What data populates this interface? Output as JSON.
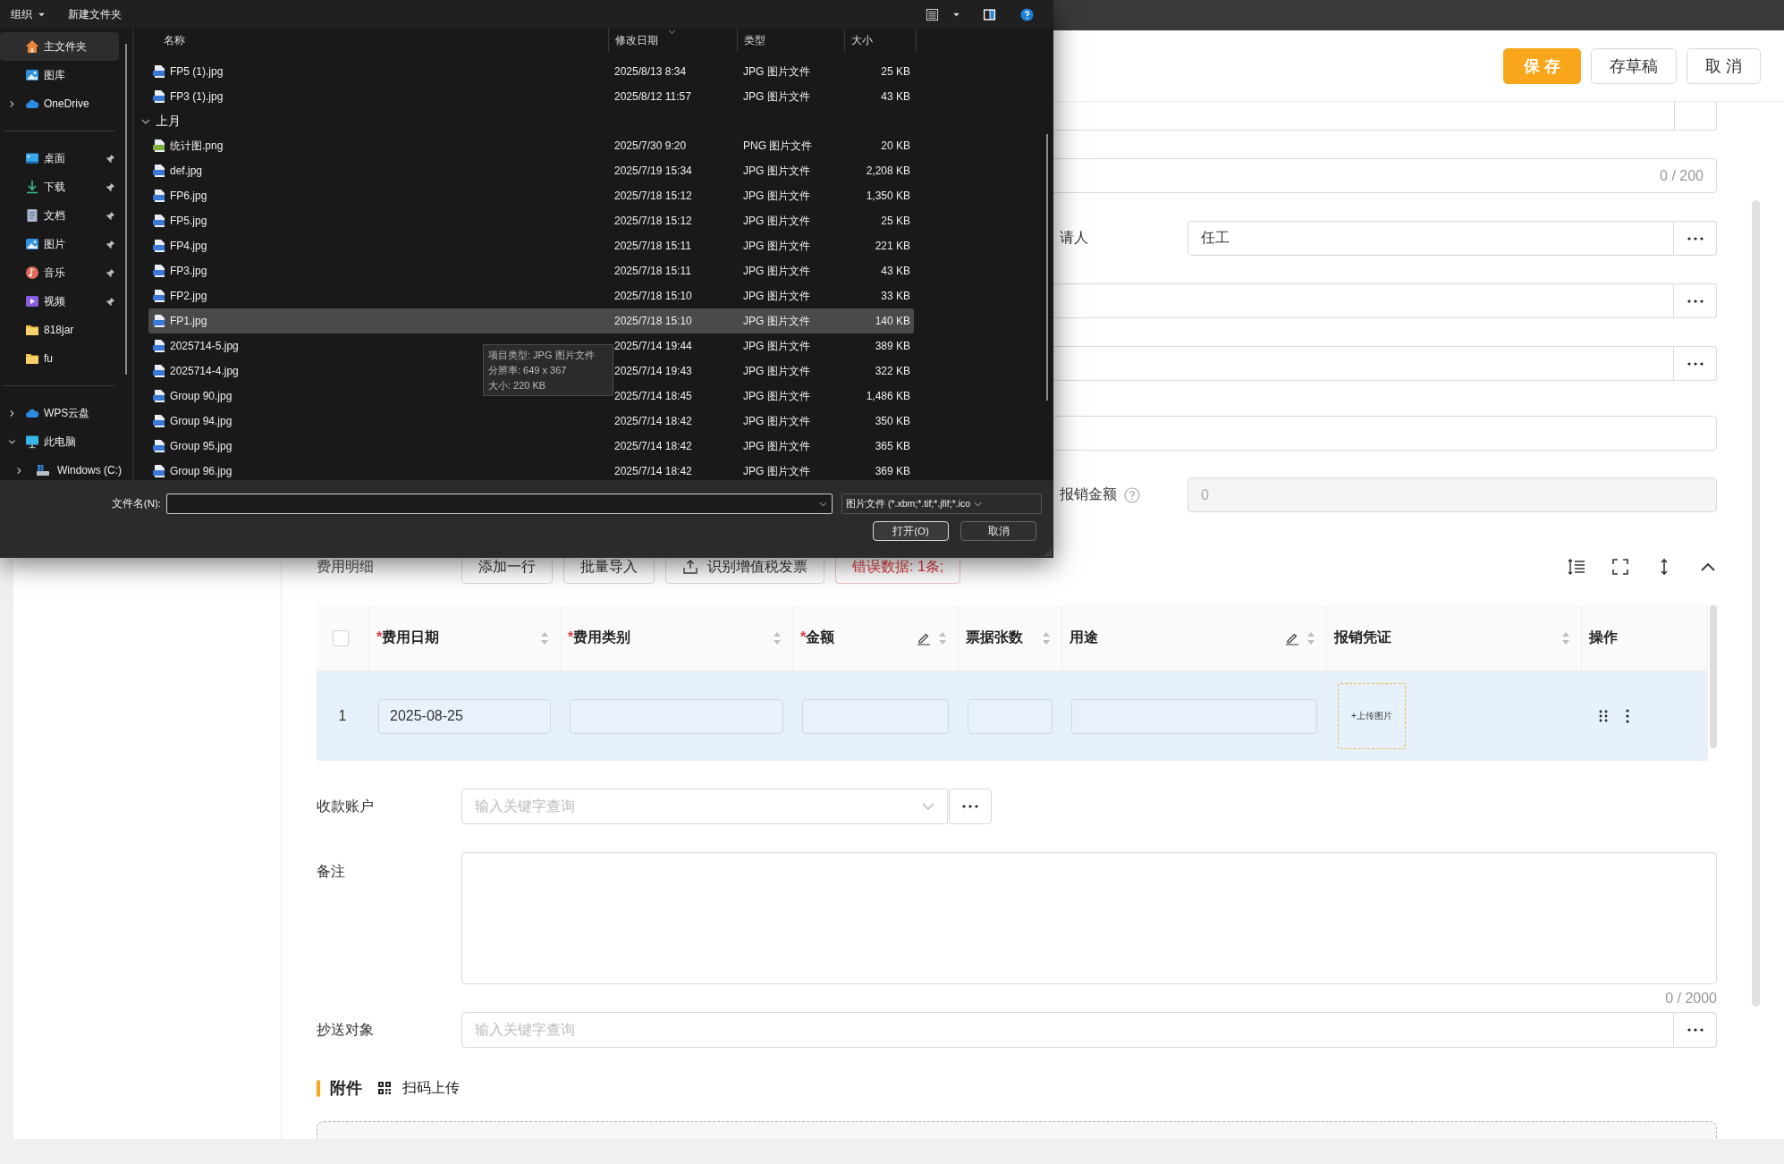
{
  "file_dialog": {
    "toolbar": {
      "organize": "组织",
      "new_folder": "新建文件夹"
    },
    "sidebar_groups": [
      [
        {
          "label": "主文件夹",
          "kind": "home",
          "selected": true,
          "pinned": false
        },
        {
          "label": "图库",
          "kind": "gallery",
          "selected": false,
          "pinned": false
        },
        {
          "label": "OneDrive",
          "kind": "cloud",
          "selected": false,
          "pinned": false,
          "expanded": false
        }
      ],
      [
        {
          "label": "桌面",
          "kind": "desktop",
          "selected": false,
          "pinned": true
        },
        {
          "label": "下载",
          "kind": "download",
          "selected": false,
          "pinned": true
        },
        {
          "label": "文档",
          "kind": "document",
          "selected": false,
          "pinned": true
        },
        {
          "label": "图片",
          "kind": "picture",
          "selected": false,
          "pinned": true
        },
        {
          "label": "音乐",
          "kind": "music",
          "selected": false,
          "pinned": true
        },
        {
          "label": "视频",
          "kind": "video",
          "selected": false,
          "pinned": true
        },
        {
          "label": "818jar",
          "kind": "folder",
          "selected": false,
          "pinned": false
        },
        {
          "label": "fu",
          "kind": "folder",
          "selected": false,
          "pinned": false
        }
      ],
      [
        {
          "label": "WPS云盘",
          "kind": "cloud",
          "selected": false,
          "pinned": false,
          "expanded": false
        },
        {
          "label": "此电脑",
          "kind": "computer",
          "selected": false,
          "pinned": false,
          "expanded": true,
          "children": [
            {
              "label": "Windows (C:)",
              "kind": "drive",
              "selected": false,
              "expanded": false
            }
          ]
        }
      ]
    ],
    "columns": [
      {
        "label": "名称",
        "sorted": false
      },
      {
        "label": "修改日期",
        "sorted": true
      },
      {
        "label": "类型",
        "sorted": false
      },
      {
        "label": "大小",
        "sorted": false
      }
    ],
    "file_groups": [
      {
        "files": [
          {
            "name": "FP5 (1).jpg",
            "date": "2025/8/13 8:34",
            "type": "JPG 图片文件",
            "size": "25 KB",
            "kind": "jpg",
            "selected": false
          },
          {
            "name": "FP3 (1).jpg",
            "date": "2025/8/12 11:57",
            "type": "JPG 图片文件",
            "size": "43 KB",
            "kind": "jpg",
            "selected": false
          }
        ]
      },
      {
        "title": "上月",
        "expanded": true,
        "files": [
          {
            "name": "统计图.png",
            "date": "2025/7/30 9:20",
            "type": "PNG 图片文件",
            "size": "20 KB",
            "kind": "png",
            "selected": false
          },
          {
            "name": "def.jpg",
            "date": "2025/7/19 15:34",
            "type": "JPG 图片文件",
            "size": "2,208 KB",
            "kind": "jpg",
            "selected": false
          },
          {
            "name": "FP6.jpg",
            "date": "2025/7/18 15:12",
            "type": "JPG 图片文件",
            "size": "1,350 KB",
            "kind": "jpg",
            "selected": false
          },
          {
            "name": "FP5.jpg",
            "date": "2025/7/18 15:12",
            "type": "JPG 图片文件",
            "size": "25 KB",
            "kind": "jpg",
            "selected": false
          },
          {
            "name": "FP4.jpg",
            "date": "2025/7/18 15:11",
            "type": "JPG 图片文件",
            "size": "221 KB",
            "kind": "jpg",
            "selected": false
          },
          {
            "name": "FP3.jpg",
            "date": "2025/7/18 15:11",
            "type": "JPG 图片文件",
            "size": "43 KB",
            "kind": "jpg",
            "selected": false
          },
          {
            "name": "FP2.jpg",
            "date": "2025/7/18 15:10",
            "type": "JPG 图片文件",
            "size": "33 KB",
            "kind": "jpg",
            "selected": false
          },
          {
            "name": "FP1.jpg",
            "date": "2025/7/18 15:10",
            "type": "JPG 图片文件",
            "size": "140 KB",
            "kind": "jpg",
            "selected": true
          },
          {
            "name": "2025714-5.jpg",
            "date": "2025/7/14 19:44",
            "type": "JPG 图片文件",
            "size": "389 KB",
            "kind": "jpg",
            "selected": false
          },
          {
            "name": "2025714-4.jpg",
            "date": "2025/7/14 19:43",
            "type": "JPG 图片文件",
            "size": "322 KB",
            "kind": "jpg",
            "selected": false
          },
          {
            "name": "Group 90.jpg",
            "date": "2025/7/14 18:45",
            "type": "JPG 图片文件",
            "size": "1,486 KB",
            "kind": "jpg",
            "selected": false
          },
          {
            "name": "Group 94.jpg",
            "date": "2025/7/14 18:42",
            "type": "JPG 图片文件",
            "size": "350 KB",
            "kind": "jpg",
            "selected": false
          },
          {
            "name": "Group 95.jpg",
            "date": "2025/7/14 18:42",
            "type": "JPG 图片文件",
            "size": "365 KB",
            "kind": "jpg",
            "selected": false
          },
          {
            "name": "Group 96.jpg",
            "date": "2025/7/14 18:42",
            "type": "JPG 图片文件",
            "size": "369 KB",
            "kind": "jpg",
            "selected": false
          }
        ]
      }
    ],
    "tooltip": {
      "lines": [
        "项目类型: JPG 图片文件",
        "分辨率: 649 x 367",
        "大小: 220 KB"
      ]
    },
    "filename": {
      "label": "文件名(N):"
    },
    "filter": {
      "value": "图片文件 (*.xbm;*.tif;*.jfif;*.ico"
    },
    "buttons": [
      {
        "label": "打开(O)",
        "default": true
      },
      {
        "label": "取消",
        "default": false
      }
    ]
  },
  "header": {
    "buttons": [
      {
        "label": "保 存",
        "kind": "primary"
      },
      {
        "label": "存草稿",
        "kind": "default"
      },
      {
        "label": "取 消",
        "kind": "default"
      }
    ]
  },
  "form_fields": [
    {
      "kind": "cut_lookup"
    },
    {
      "kind": "counter",
      "counter": "0 / 200"
    },
    {
      "kind": "lookup",
      "label": "请人",
      "value": "任工",
      "help": false
    },
    {
      "kind": "lookup"
    },
    {
      "kind": "lookup"
    },
    {
      "kind": "text"
    },
    {
      "kind": "disabled",
      "label": "报销金额",
      "value": "0",
      "help": true
    }
  ],
  "detail": {
    "title": "费用明细",
    "buttons": [
      {
        "label": "添加一行",
        "kind": "plain"
      },
      {
        "label": "批量导入",
        "kind": "plain"
      },
      {
        "label": "识别增值税发票",
        "kind": "icon"
      },
      {
        "label": "错误数据: 1条;",
        "kind": "error"
      }
    ],
    "table": {
      "select_all_checked": false,
      "columns": [
        {
          "label": "费用日期",
          "prefix": "*",
          "sortable": true,
          "editable": false
        },
        {
          "label": "费用类别",
          "prefix": "*",
          "sortable": true,
          "editable": false
        },
        {
          "label": "金额",
          "prefix": "*",
          "sortable": true,
          "editable": true
        },
        {
          "label": "票据张数",
          "sortable": true,
          "editable": false
        },
        {
          "label": "用途",
          "sortable": true,
          "editable": true
        },
        {
          "label": "报销凭证",
          "sortable": true,
          "editable": false
        },
        {
          "label": "操作",
          "sortable": false,
          "editable": false
        }
      ],
      "rows": [
        {
          "index": "1",
          "selected": true,
          "cells": [
            {
              "kind": "input",
              "value": "2025-08-25"
            },
            {
              "kind": "input"
            },
            {
              "kind": "input"
            },
            {
              "kind": "input"
            },
            {
              "kind": "input"
            },
            {
              "kind": "upload",
              "label": "+上传图片"
            },
            {
              "kind": "actions"
            }
          ]
        }
      ]
    }
  },
  "payee": {
    "label": "收款账户",
    "placeholder": "输入关键字查询"
  },
  "remark": {
    "label": "备注",
    "counter": "0 / 2000"
  },
  "cc": {
    "label": "抄送对象",
    "placeholder": "输入关键字查询"
  },
  "attachments": {
    "title": "附件",
    "scan": "扫码上传"
  }
}
